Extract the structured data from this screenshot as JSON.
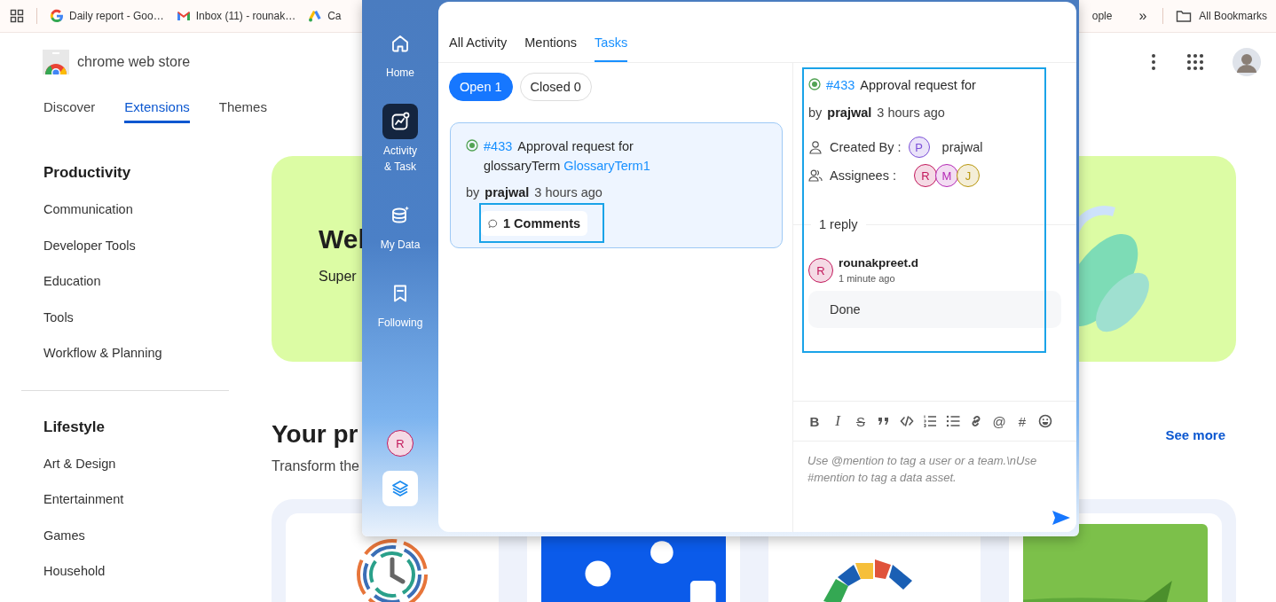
{
  "bookmarks": {
    "items": [
      {
        "label": "Daily report - Goo…",
        "kind": "google"
      },
      {
        "label": "Inbox (11) - rounak…",
        "kind": "mail"
      },
      {
        "label": "Ca",
        "kind": "ads"
      }
    ],
    "trailing": [
      {
        "label": "ople"
      }
    ],
    "overflow": "»",
    "all_bookmarks": "All Bookmarks"
  },
  "store": {
    "title": "chrome web store",
    "nav": [
      {
        "label": "Discover",
        "selected": false
      },
      {
        "label": "Extensions",
        "selected": true
      },
      {
        "label": "Themes",
        "selected": false
      }
    ],
    "categories": [
      {
        "heading": "Productivity",
        "items": [
          "Communication",
          "Developer Tools",
          "Education",
          "Tools",
          "Workflow & Planning"
        ]
      },
      {
        "heading": "Lifestyle",
        "items": [
          "Art & Design",
          "Entertainment",
          "Games",
          "Household"
        ]
      }
    ],
    "hero": {
      "title": "Wel",
      "subtitle": "Super"
    },
    "section": {
      "title": "Your pr",
      "subtitle": "Transform the",
      "link": "See more",
      "cards": [
        {
          "kind": "clock-logo"
        },
        {
          "kind": "picture"
        },
        {
          "kind": "arc-logo"
        },
        {
          "kind": "picture"
        }
      ]
    }
  },
  "popup": {
    "rail": [
      {
        "label": "Home",
        "kind": "home",
        "selected": false
      },
      {
        "label": "Activity & Task",
        "kind": "activity",
        "selected": true
      },
      {
        "label": "My Data",
        "kind": "data",
        "selected": false
      },
      {
        "label": "Following",
        "kind": "bookmark",
        "selected": false
      }
    ],
    "user": {
      "initial": "R",
      "color": "#c2185b"
    },
    "tabs": [
      {
        "label": "All Activity",
        "selected": false
      },
      {
        "label": "Mentions",
        "selected": false
      },
      {
        "label": "Tasks",
        "selected": true
      }
    ],
    "filters": [
      {
        "label": "Open 1",
        "selected": true
      },
      {
        "label": "Closed 0",
        "selected": false
      }
    ],
    "task": {
      "number": "#433",
      "title": "Approval request for",
      "entity_type": "glossaryTerm",
      "entity_link": "GlossaryTerm1",
      "by": "by",
      "author": "prajwal",
      "time": "3 hours ago",
      "comments": "1 Comments",
      "highlighted": true
    },
    "detail": {
      "number": "#433",
      "title": "Approval request for",
      "by": "by",
      "author": "prajwal",
      "time": "3 hours ago",
      "created_by_label": "Created By :",
      "creator": {
        "initial": "P",
        "name": "prajwal",
        "color": "#7b4fd8"
      },
      "assignees_label": "Assignees :",
      "assignees": [
        {
          "initial": "R",
          "color": "#c2185b"
        },
        {
          "initial": "M",
          "color": "#b52ab5"
        },
        {
          "initial": "J",
          "color": "#b8960c"
        }
      ],
      "reply_count": "1 reply",
      "replies": [
        {
          "initial": "R",
          "color": "#c2185b",
          "author": "rounakpreet.d",
          "time": "1 minute ago",
          "text": "Done"
        }
      ],
      "highlighted": true
    },
    "editor": {
      "toolbar": [
        {
          "kind": "bold",
          "glyph": "B"
        },
        {
          "kind": "italic",
          "glyph": "I"
        },
        {
          "kind": "strike",
          "glyph": "S"
        },
        {
          "kind": "quote"
        },
        {
          "kind": "code"
        },
        {
          "kind": "ordered-list"
        },
        {
          "kind": "bullet-list"
        },
        {
          "kind": "link"
        },
        {
          "kind": "mention",
          "glyph": "@"
        },
        {
          "kind": "hashtag",
          "glyph": "#"
        },
        {
          "kind": "emoji"
        }
      ],
      "placeholder": "Use @mention to tag a user or a team.\\nUse #mention to tag a data asset."
    }
  }
}
